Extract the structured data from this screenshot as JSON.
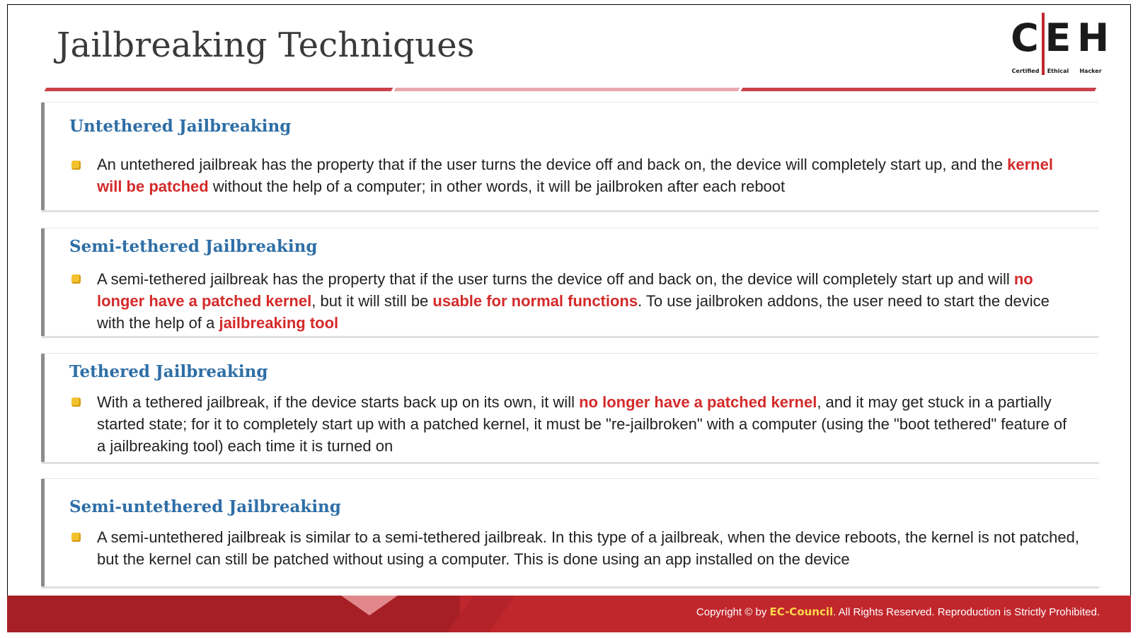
{
  "slide": {
    "title": "Jailbreaking Techniques"
  },
  "logo": {
    "letters": [
      "C",
      "E",
      "H"
    ],
    "subtitle": [
      "Certified",
      "Ethical",
      "Hacker"
    ]
  },
  "sections": [
    {
      "heading": "Untethered Jailbreaking",
      "segments": [
        {
          "t": "An untethered jailbreak has the property that if the user turns the device off and back on, the device will completely start up, and the ",
          "h": false
        },
        {
          "t": "kernel will be patched",
          "h": true
        },
        {
          "t": " without the help of a computer; in other words, it will be jailbroken after each reboot",
          "h": false
        }
      ]
    },
    {
      "heading": "Semi-tethered Jailbreaking",
      "segments": [
        {
          "t": "A semi-tethered jailbreak has the property that if the user turns the device off and back on, the device will completely start up and will ",
          "h": false
        },
        {
          "t": "no longer have a patched kernel",
          "h": true
        },
        {
          "t": ", but it will still be ",
          "h": false
        },
        {
          "t": "usable for normal functions",
          "h": true
        },
        {
          "t": ". To use jailbroken addons, the user need to start the device with the help of a ",
          "h": false
        },
        {
          "t": "jailbreaking tool",
          "h": true
        }
      ]
    },
    {
      "heading": "Tethered Jailbreaking",
      "segments": [
        {
          "t": "With a tethered jailbreak, if the device starts back up on its own, it will ",
          "h": false
        },
        {
          "t": "no longer have a patched kernel",
          "h": true
        },
        {
          "t": ", and it may get stuck in a partially started state; for it to completely start up with a patched kernel, it must be \"re-jailbroken\" with a computer (using the \"boot tethered\" feature of a jailbreaking tool) each time it is turned on",
          "h": false
        }
      ]
    },
    {
      "heading": "Semi-untethered Jailbreaking",
      "segments": [
        {
          "t": "A semi-untethered jailbreak is similar to a semi-tethered jailbreak. In this type of a jailbreak, when the device reboots, the kernel is not patched, but the kernel can still be patched without using a computer. This is done using an app installed on the device",
          "h": false
        }
      ]
    }
  ],
  "footer": {
    "copyright_prefix": "Copyright © by ",
    "brand": "EC-Council",
    "copyright_suffix": ". All Rights Reserved. Reproduction is Strictly Prohibited."
  },
  "colors": {
    "heading": "#2e6ea6",
    "highlight": "#d42a2a",
    "brand_red": "#c0272d",
    "bullet": "#f2c12e"
  }
}
